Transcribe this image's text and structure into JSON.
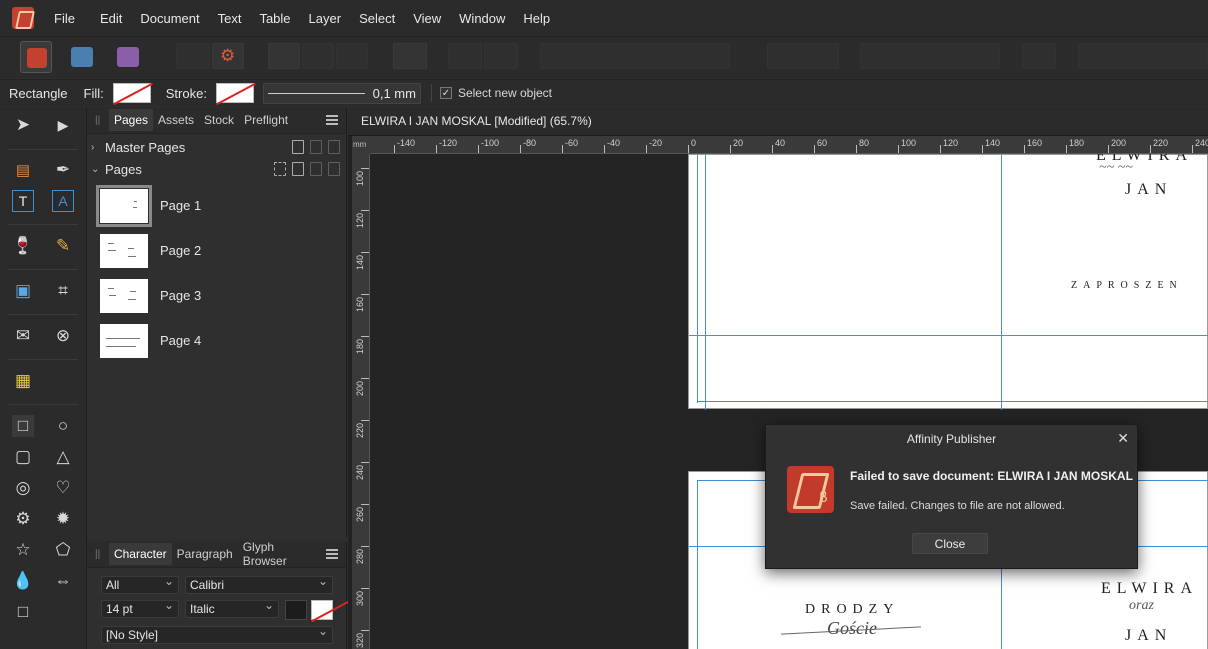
{
  "menu": [
    "File",
    "Edit",
    "Document",
    "Text",
    "Table",
    "Layer",
    "Select",
    "View",
    "Window",
    "Help"
  ],
  "context_bar": {
    "tool_name": "Rectangle",
    "fill_label": "Fill:",
    "stroke_label": "Stroke:",
    "stroke_width": "0,1 mm",
    "select_new_object": "Select new object"
  },
  "pages_panel": {
    "tabs": [
      "Pages",
      "Assets",
      "Stock",
      "Preflight"
    ],
    "master_pages_label": "Master Pages",
    "pages_label": "Pages",
    "pages": [
      "Page 1",
      "Page 2",
      "Page 3",
      "Page 4"
    ]
  },
  "character_panel": {
    "tabs": [
      "Character",
      "Paragraph",
      "Glyph Browser"
    ],
    "scope": "All",
    "font": "Calibri",
    "size": "14 pt",
    "style": "Italic",
    "paragraph_style": "[No Style]"
  },
  "document": {
    "title": "ELWIRA I JAN MOSKAL [Modified] (65.7%)",
    "ruler_unit": "mm",
    "ruler_h_ticks": [
      "-140",
      "-120",
      "-100",
      "-80",
      "-60",
      "-40",
      "-20",
      "0",
      "20",
      "40",
      "60",
      "80",
      "100",
      "120",
      "140",
      "160",
      "180",
      "200",
      "220",
      "240"
    ],
    "ruler_v_ticks": [
      "100",
      "120",
      "140",
      "160",
      "180",
      "200",
      "220",
      "240",
      "260",
      "280",
      "300",
      "320"
    ],
    "page1_text": {
      "names_top": "ELWIRA",
      "jan": "JAN",
      "invite": "ZAPROSZEN"
    },
    "page2_text": {
      "dear_guests": "DRODZY",
      "script": "Goście",
      "elwira": "ELWIRA",
      "oraz": "oraz",
      "jan": "JAN"
    }
  },
  "dialog": {
    "title": "Affinity Publisher",
    "icon_badge": "β",
    "heading": "Failed to save document: ELWIRA I JAN MOSKAL",
    "message": "Save failed. Changes to file are not allowed.",
    "button": "Close"
  }
}
